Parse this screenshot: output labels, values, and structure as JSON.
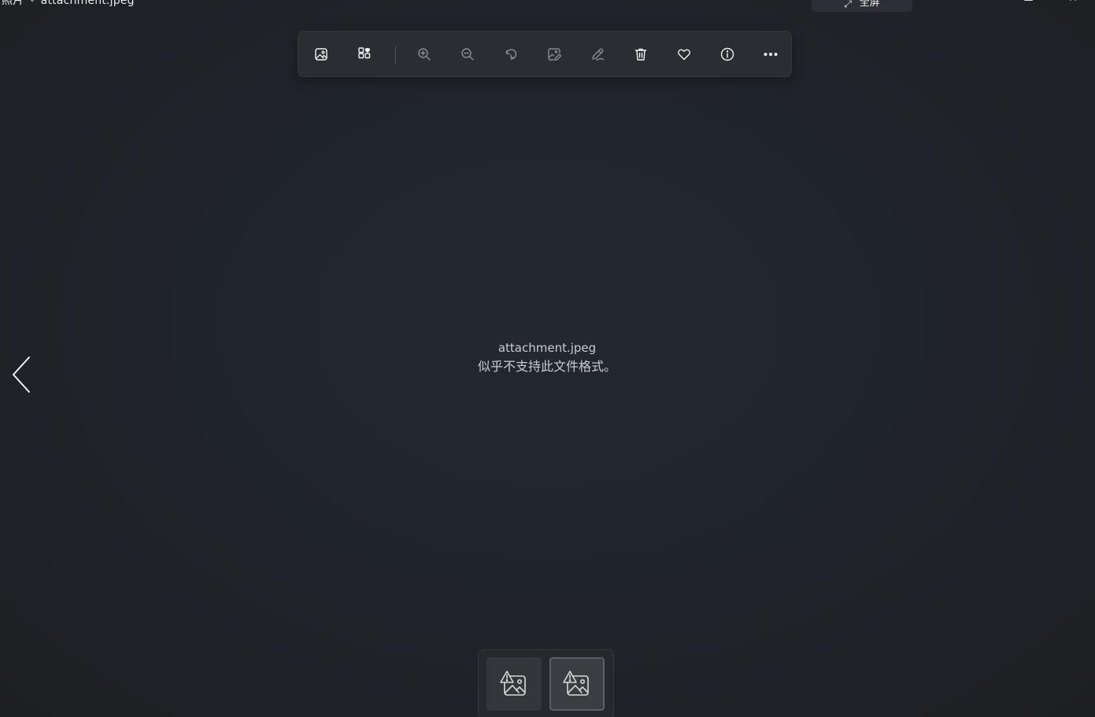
{
  "window": {
    "app_name": "照片",
    "separator": "-",
    "file_title": "attachment.jpeg",
    "fullscreen_label": "全屏",
    "maximize_glyph": "",
    "close_glyph": "✕"
  },
  "toolbar": {
    "items": [
      {
        "name": "view-image-icon",
        "state": "enabled"
      },
      {
        "name": "add-to-album-icon",
        "state": "enabled"
      },
      {
        "name": "zoom-in-icon",
        "state": "disabled"
      },
      {
        "name": "zoom-out-icon",
        "state": "disabled"
      },
      {
        "name": "rotate-icon",
        "state": "disabled"
      },
      {
        "name": "edit-image-icon",
        "state": "disabled"
      },
      {
        "name": "markup-pen-icon",
        "state": "disabled"
      },
      {
        "name": "delete-icon",
        "state": "enabled"
      },
      {
        "name": "favorite-heart-icon",
        "state": "enabled"
      },
      {
        "name": "info-icon",
        "state": "enabled"
      },
      {
        "name": "more-options-icon",
        "state": "enabled"
      }
    ]
  },
  "message": {
    "filename": "attachment.jpeg",
    "error": "似乎不支持此文件格式。"
  },
  "filmstrip": {
    "thumbnails": [
      {
        "name": "broken-image-thumbnail",
        "selected": false
      },
      {
        "name": "broken-image-thumbnail",
        "selected": true
      }
    ]
  },
  "colors": {
    "background": "#202326",
    "toolbar": "#2a2d31",
    "icon_enabled": "#f2f2f2",
    "icon_disabled": "#8a8d91",
    "text_muted": "#c9cbce"
  }
}
